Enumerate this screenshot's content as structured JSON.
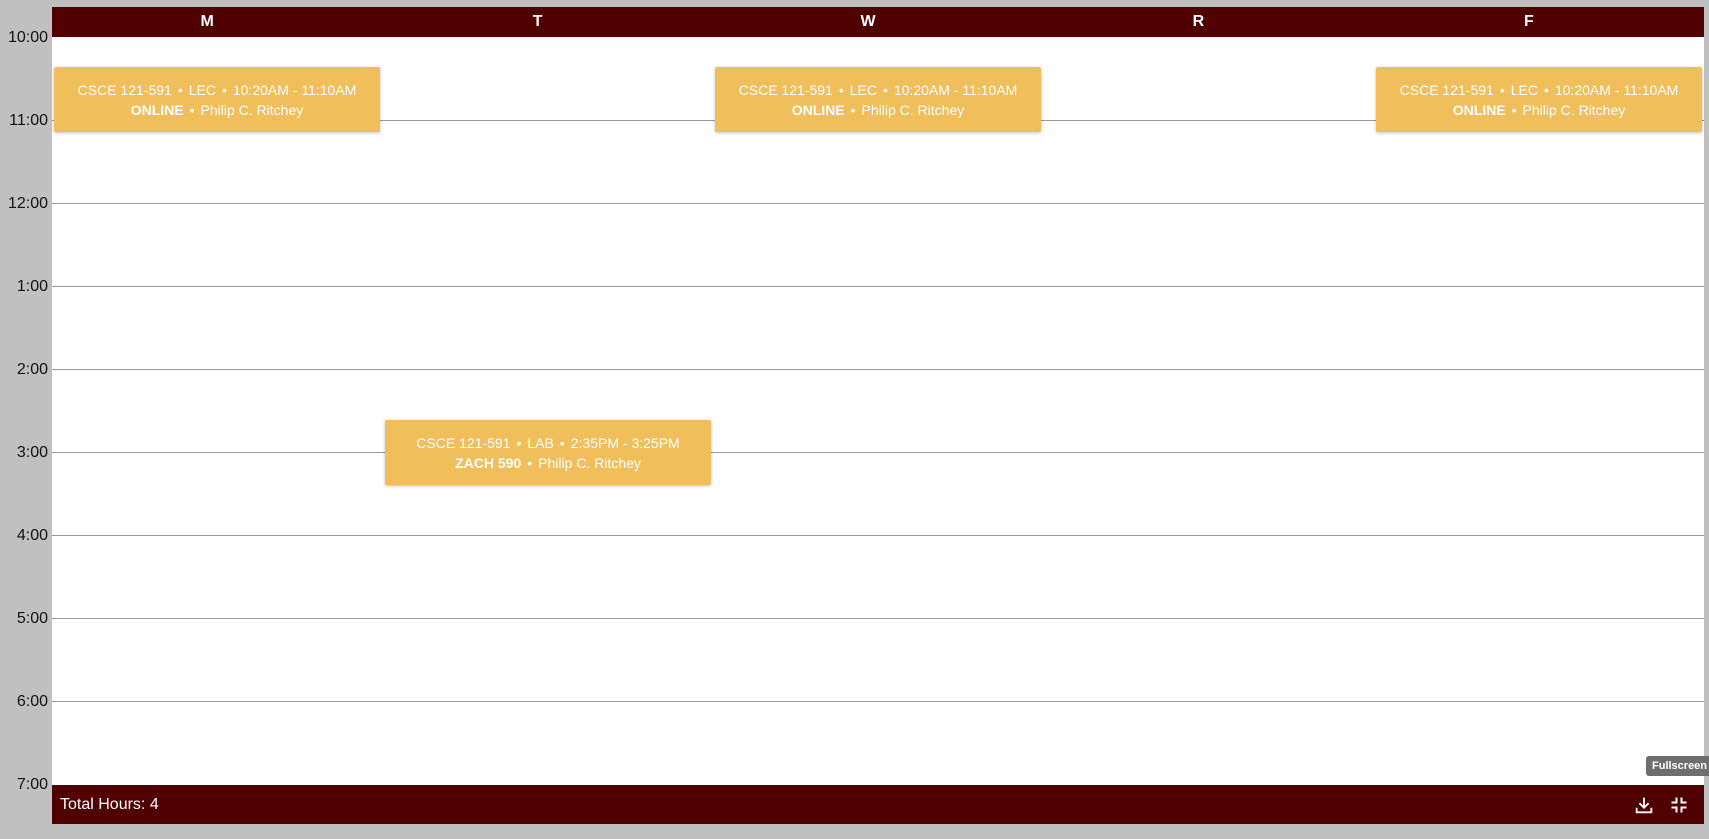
{
  "days": [
    "M",
    "T",
    "W",
    "R",
    "F"
  ],
  "times": [
    "10:00",
    "11:00",
    "12:00",
    "1:00",
    "2:00",
    "3:00",
    "4:00",
    "5:00",
    "6:00",
    "7:00"
  ],
  "events": [
    {
      "course": "CSCE 121-591",
      "type": "LEC",
      "time": "10:20AM - 11:10AM",
      "location": "ONLINE",
      "instructor": "Philip C. Ritchey"
    },
    {
      "course": "CSCE 121-591",
      "type": "LEC",
      "time": "10:20AM - 11:10AM",
      "location": "ONLINE",
      "instructor": "Philip C. Ritchey"
    },
    {
      "course": "CSCE 121-591",
      "type": "LEC",
      "time": "10:20AM - 11:10AM",
      "location": "ONLINE",
      "instructor": "Philip C. Ritchey"
    },
    {
      "course": "CSCE 121-591",
      "type": "LAB",
      "time": "2:35PM - 3:25PM",
      "location": "ZACH 590",
      "instructor": "Philip C. Ritchey"
    }
  ],
  "footer": {
    "total_hours": "Total Hours: 4",
    "tooltip": "Fullscreen",
    "download_icon": "download-icon",
    "fullscreen_icon": "exit-fullscreen-icon"
  },
  "colors": {
    "maroon": "#500000",
    "event": "#f0bf5c",
    "background": "#c0c0c0"
  }
}
